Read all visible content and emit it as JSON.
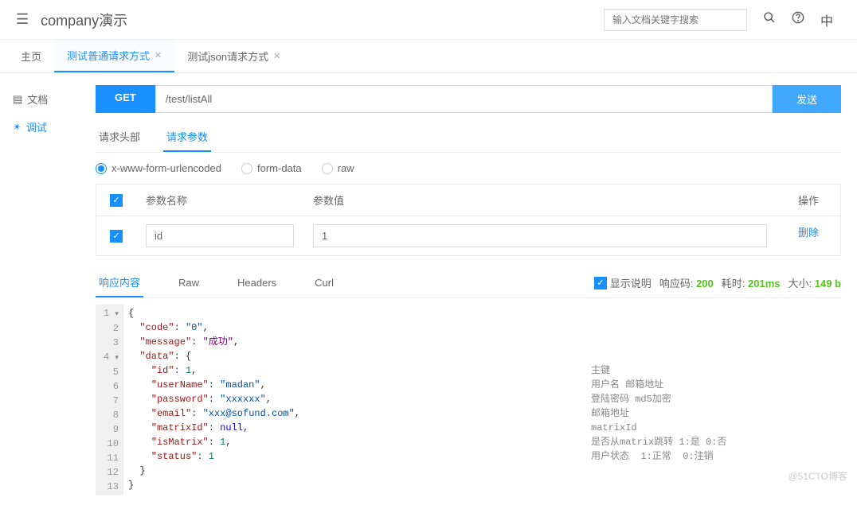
{
  "header": {
    "title": "company演示",
    "search_placeholder": "输入文档关键字搜索",
    "lang": "中"
  },
  "tabs": [
    {
      "label": "主页",
      "active": false,
      "closable": false
    },
    {
      "label": "测试普通请求方式",
      "active": true,
      "closable": true
    },
    {
      "label": "测试json请求方式",
      "active": false,
      "closable": true
    }
  ],
  "sidebar": {
    "doc": "文档",
    "debug": "调试"
  },
  "request": {
    "method": "GET",
    "url": "/test/listAll",
    "send": "发送"
  },
  "req_tabs": {
    "headers": "请求头部",
    "params": "请求参数"
  },
  "body_types": {
    "form_url": "x-www-form-urlencoded",
    "form_data": "form-data",
    "raw": "raw"
  },
  "param_table": {
    "col_name": "参数名称",
    "col_value": "参数值",
    "col_action": "操作",
    "rows": [
      {
        "name": "id",
        "value": "1"
      }
    ],
    "delete": "删除"
  },
  "resp_tabs": {
    "content": "响应内容",
    "raw": "Raw",
    "headers": "Headers",
    "curl": "Curl"
  },
  "resp_info": {
    "show_desc": "显示说明",
    "code_label": "响应码:",
    "code": "200",
    "time_label": "耗时:",
    "time": "201ms",
    "size_label": "大小:",
    "size": "149 b"
  },
  "response_json": {
    "code": "0",
    "message": "成功",
    "data": {
      "id": 1,
      "userName": "madan",
      "password": "xxxxxx",
      "email": "xxx@sofund.com",
      "matrixId": null,
      "isMatrix": 1,
      "status": 1
    }
  },
  "field_desc": {
    "id": "主键",
    "userName": "用户名 邮箱地址",
    "password": "登陆密码 md5加密",
    "email": "邮箱地址",
    "matrixId": "matrixId",
    "isMatrix": "是否从matrix跳转 1:是 0:否",
    "status": "用户状态  1:正常  0:注销"
  },
  "watermark": "@51CTO博客"
}
